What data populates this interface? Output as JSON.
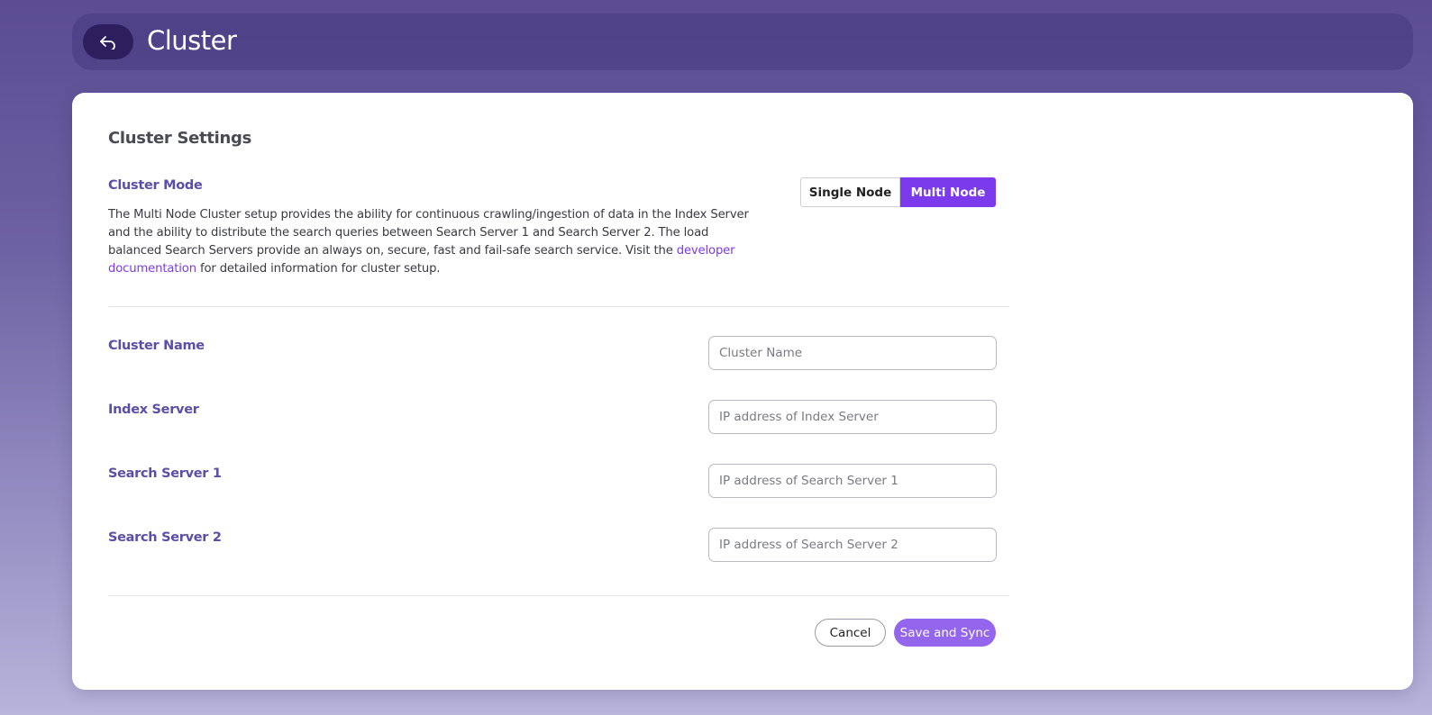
{
  "header": {
    "title": "Cluster",
    "back_icon": "back-arrow-icon"
  },
  "settings": {
    "title": "Cluster Settings",
    "mode_label": "Cluster Mode",
    "description_text": "The Multi Node Cluster setup provides the ability for continuous crawling/ingestion of data in the Index Server and the ability to distribute the search queries between Search Server 1 and Search Server 2. The load balanced Search Servers provide an always on, secure, fast and fail-safe search service. Visit the ",
    "description_link": "developer documentation",
    "description_suffix": " for detailed information for cluster setup.",
    "mode_options": [
      "Single Node",
      "Multi Node"
    ],
    "selected_mode": "Multi Node"
  },
  "fields": {
    "cluster_name": {
      "label": "Cluster Name",
      "placeholder": "Cluster Name",
      "value": ""
    },
    "index_server": {
      "label": "Index Server",
      "placeholder": "IP address of Index Server",
      "value": ""
    },
    "search_server_1": {
      "label": "Search Server 1",
      "placeholder": "IP address of Search Server 1",
      "value": ""
    },
    "search_server_2": {
      "label": "Search Server 2",
      "placeholder": "IP address of Search Server 2",
      "value": ""
    }
  },
  "actions": {
    "cancel": "Cancel",
    "save": "Save and Sync"
  },
  "colors": {
    "accent": "#7c3aed",
    "save_button": "#9466ee",
    "label": "#5a4fa8"
  }
}
